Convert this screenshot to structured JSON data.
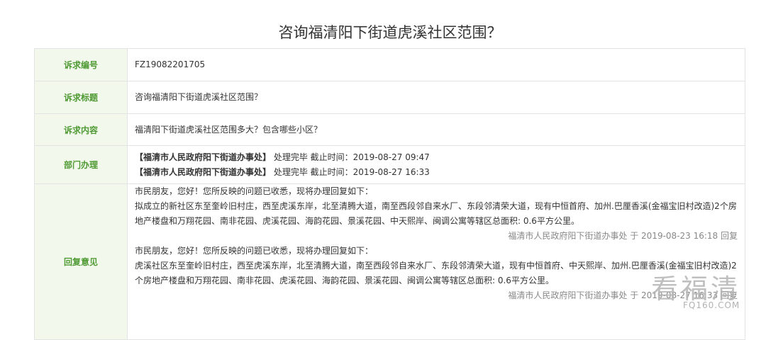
{
  "title": "咨询福清阳下街道虎溪社区范围？",
  "rows": {
    "number": {
      "label": "诉求编号",
      "value": "FZ19082201705"
    },
    "subject": {
      "label": "诉求标题",
      "value": "咨询福清阳下街道虎溪社区范围？"
    },
    "content": {
      "label": "诉求内容",
      "value": "福清阳下街道虎溪社区范围多大？包含哪些小区？"
    },
    "dept": {
      "label": "部门办理",
      "items": [
        {
          "dept": "【福清市人民政府阳下街道办事处】",
          "status": "处理完毕 截止时间：2019-08-27 09:47"
        },
        {
          "dept": "【福清市人民政府阳下街道办事处】",
          "status": "处理完毕 截止时间：2019-08-27 16:33"
        }
      ]
    },
    "reply": {
      "label": "回复意见",
      "items": [
        {
          "greeting": "市民朋友，您好！您所反映的问题已收悉，现将办理回复如下：",
          "body": "拟成立的新社区东至奎岭旧村庄，西至虎溪东岸，北至清腾大道，南至西段邻自来水厂、东段邻清荣大道，现有中恒首府、加州.巴厘香溪(金福宝旧村改造)2个房地产楼盘和万翔花园、南非花园、虎溪花园、海韵花园、景溪花园、中天熙岸、闽调公寓等辖区总面积: 0.6平方公里。",
          "signature": "福清市人民政府阳下街道办事处 于 2019-08-23 16:18 回复"
        },
        {
          "greeting": "市民朋友，您好！您所反映的问题已收悉，现将办理回复如下：",
          "body": "虎溪社区东至奎岭旧村庄，西至虎溪东岸，北至清腾大道，南至西段邻自来水厂、东段邻清荣大道，现有中恒首府、中天熙岸、加州.巴厘香溪(金福宝旧村改造)2个房地产楼盘和万翔花园、南非花园、虎溪花园、海韵花园、景溪花园、闽调公寓等辖区总面积: 0.6平方公里。",
          "signature": "福清市人民政府阳下街道办事处 于 2019-08-27 16:33 回复"
        }
      ]
    }
  },
  "watermark": {
    "text": "看福清",
    "url": "FQ160.COM"
  }
}
